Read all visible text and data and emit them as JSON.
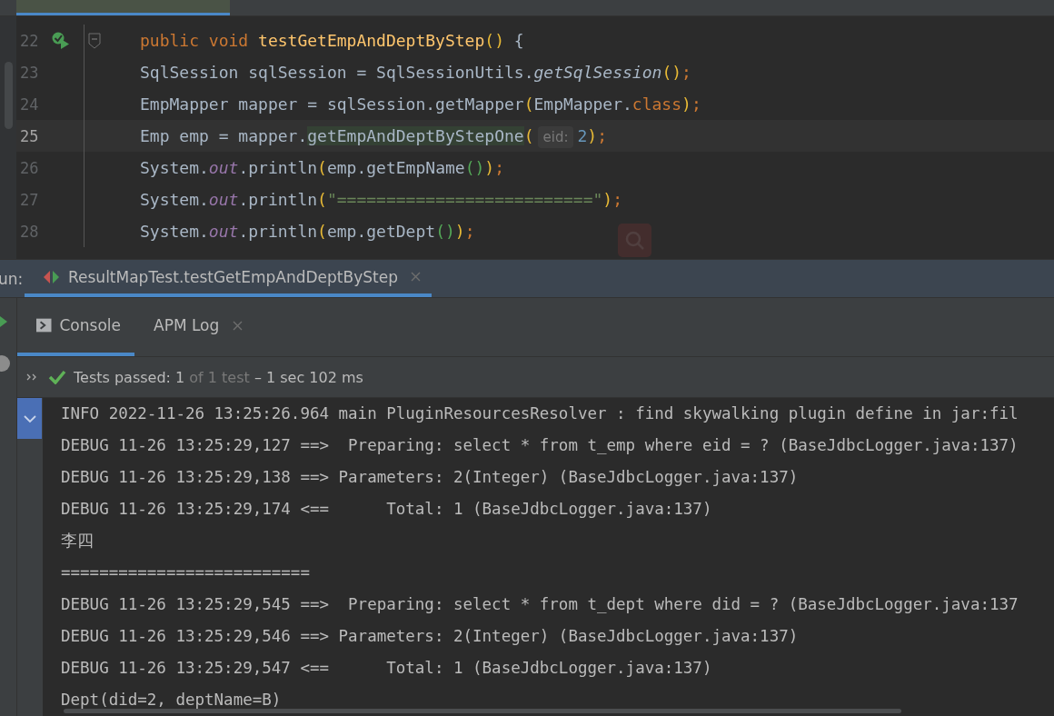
{
  "editor": {
    "lines": [
      {
        "number": "22",
        "current": false,
        "run_marker": true,
        "fold_marker": true,
        "tokens": [
          {
            "kind": "kw",
            "text": "public void "
          },
          {
            "kind": "decl",
            "text": "testGetEmpAndDeptByStep"
          },
          {
            "kind": "by",
            "text": "()"
          },
          {
            "kind": "plain",
            "text": " {"
          }
        ]
      },
      {
        "number": "23",
        "current": false,
        "run_marker": false,
        "fold_marker": false,
        "tokens": [
          {
            "kind": "plain",
            "text": "SqlSession sqlSession = SqlSessionUtils."
          },
          {
            "kind": "italic",
            "text": "getSqlSession"
          },
          {
            "kind": "by",
            "text": "()"
          },
          {
            "kind": "punct",
            "text": ";"
          }
        ]
      },
      {
        "number": "24",
        "current": false,
        "run_marker": false,
        "fold_marker": false,
        "tokens": [
          {
            "kind": "plain",
            "text": "EmpMapper mapper = sqlSession.getMapper"
          },
          {
            "kind": "by",
            "text": "("
          },
          {
            "kind": "plain",
            "text": "EmpMapper."
          },
          {
            "kind": "kw",
            "text": "class"
          },
          {
            "kind": "by",
            "text": ")"
          },
          {
            "kind": "punct",
            "text": ";"
          }
        ]
      },
      {
        "number": "25",
        "current": true,
        "run_marker": false,
        "fold_marker": false,
        "tokens": [
          {
            "kind": "plain",
            "text": "Emp emp = mapper."
          },
          {
            "kind": "match",
            "text": "getEmpAndDeptByStepOne"
          },
          {
            "kind": "by",
            "text": "("
          },
          {
            "kind": "hint",
            "text": "eid:"
          },
          {
            "kind": "num",
            "text": "2"
          },
          {
            "kind": "by",
            "text": ")"
          },
          {
            "kind": "punct",
            "text": ";"
          }
        ]
      },
      {
        "number": "26",
        "current": false,
        "run_marker": false,
        "fold_marker": false,
        "tokens": [
          {
            "kind": "plain",
            "text": "System."
          },
          {
            "kind": "static",
            "text": "out"
          },
          {
            "kind": "plain",
            "text": ".println"
          },
          {
            "kind": "by",
            "text": "("
          },
          {
            "kind": "plain",
            "text": "emp.getEmpName"
          },
          {
            "kind": "bg",
            "text": "()"
          },
          {
            "kind": "by",
            "text": ")"
          },
          {
            "kind": "punct",
            "text": ";"
          }
        ]
      },
      {
        "number": "27",
        "current": false,
        "run_marker": false,
        "fold_marker": false,
        "tokens": [
          {
            "kind": "plain",
            "text": "System."
          },
          {
            "kind": "static",
            "text": "out"
          },
          {
            "kind": "plain",
            "text": ".println"
          },
          {
            "kind": "by",
            "text": "("
          },
          {
            "kind": "str",
            "text": "\"==========================\""
          },
          {
            "kind": "by",
            "text": ")"
          },
          {
            "kind": "punct",
            "text": ";"
          }
        ]
      },
      {
        "number": "28",
        "current": false,
        "run_marker": false,
        "fold_marker": false,
        "tokens": [
          {
            "kind": "plain",
            "text": "System."
          },
          {
            "kind": "static",
            "text": "out"
          },
          {
            "kind": "plain",
            "text": ".println"
          },
          {
            "kind": "by",
            "text": "("
          },
          {
            "kind": "plain",
            "text": "emp.getDept"
          },
          {
            "kind": "bg",
            "text": "()"
          },
          {
            "kind": "by",
            "text": ")"
          },
          {
            "kind": "punct",
            "text": ";"
          }
        ]
      }
    ]
  },
  "run_panel": {
    "label": "un:",
    "tab": {
      "title": "ResultMapTest.testGetEmpAndDeptByStep",
      "selected": true
    },
    "tabs": [
      {
        "label": "Console",
        "selected": true,
        "closable": false
      },
      {
        "label": "APM Log",
        "selected": false,
        "closable": true
      }
    ],
    "status": {
      "prefix": "Tests passed: 1",
      "muted": "of 1 test",
      "suffix": "– 1 sec 102 ms"
    },
    "console": [
      "INFO 2022-11-26 13:25:26.964 main PluginResourcesResolver : find skywalking plugin define in jar:fil",
      "DEBUG 11-26 13:25:29,127 ==>  Preparing: select * from t_emp where eid = ? (BaseJdbcLogger.java:137)",
      "DEBUG 11-26 13:25:29,138 ==> Parameters: 2(Integer) (BaseJdbcLogger.java:137)",
      "DEBUG 11-26 13:25:29,174 <==      Total: 1 (BaseJdbcLogger.java:137)",
      "李四",
      "==========================",
      "DEBUG 11-26 13:25:29,545 ==>  Preparing: select * from t_dept where did = ? (BaseJdbcLogger.java:137",
      "DEBUG 11-26 13:25:29,546 ==> Parameters: 2(Integer) (BaseJdbcLogger.java:137)",
      "DEBUG 11-26 13:25:29,547 <==      Total: 1 (BaseJdbcLogger.java:137)",
      "Dept(did=2, deptName=B)"
    ]
  }
}
